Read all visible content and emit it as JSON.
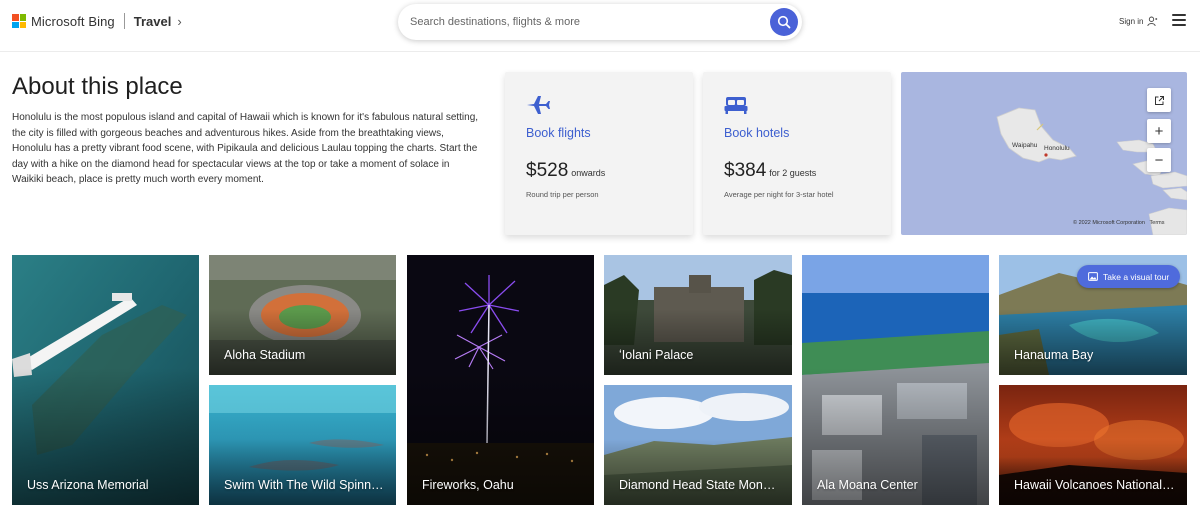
{
  "header": {
    "brand_name": "Microsoft Bing",
    "section": "Travel",
    "section_chevron": "›",
    "search_placeholder": "Search destinations, flights & more",
    "signin_label": "Sign in"
  },
  "about": {
    "title": "About this place",
    "description": "Honolulu is the most populous island and capital of Hawaii which is known for it's fabulous natural setting, the city is filled with gorgeous beaches and adventurous hikes. Aside from the breathtaking views, Honolulu has a pretty vibrant food scene, with Pipikaula and delicious Laulau topping the charts. Start the day with a hike on the diamond head for spectacular views at the top or take a moment of solace in Waikiki beach, place is pretty much worth every moment."
  },
  "cards": [
    {
      "icon": "airplane-icon",
      "label": "Book flights",
      "price": "$528",
      "price_suffix": "onwards",
      "note": "Round trip per person"
    },
    {
      "icon": "bed-icon",
      "label": "Book hotels",
      "price": "$384",
      "price_suffix": "for 2 guests",
      "note": "Average per night for 3-star hotel"
    }
  ],
  "map": {
    "labels": {
      "waipahu": "Waipahu",
      "honolulu": "Honolulu"
    },
    "zoom_in": "+",
    "zoom_out": "−",
    "copyright": "© 2022 Microsoft Corporation",
    "terms": "Terms"
  },
  "tour_button": "Take a visual tour",
  "attractions": [
    "Uss Arizona Memorial",
    "Aloha Stadium",
    "Swim With The Wild Spinner Dolphins",
    "Fireworks, Oahu",
    "ʻIolani Palace",
    "Diamond Head State Monument",
    "Ala Moana Center",
    "Hanauma Bay",
    "Hawaii Volcanoes National Park"
  ],
  "colors": {
    "accent": "#4a62d8",
    "link": "#3d5fcf",
    "card_bg": "#f3f3f3",
    "map_water": "#a9b6e0"
  }
}
